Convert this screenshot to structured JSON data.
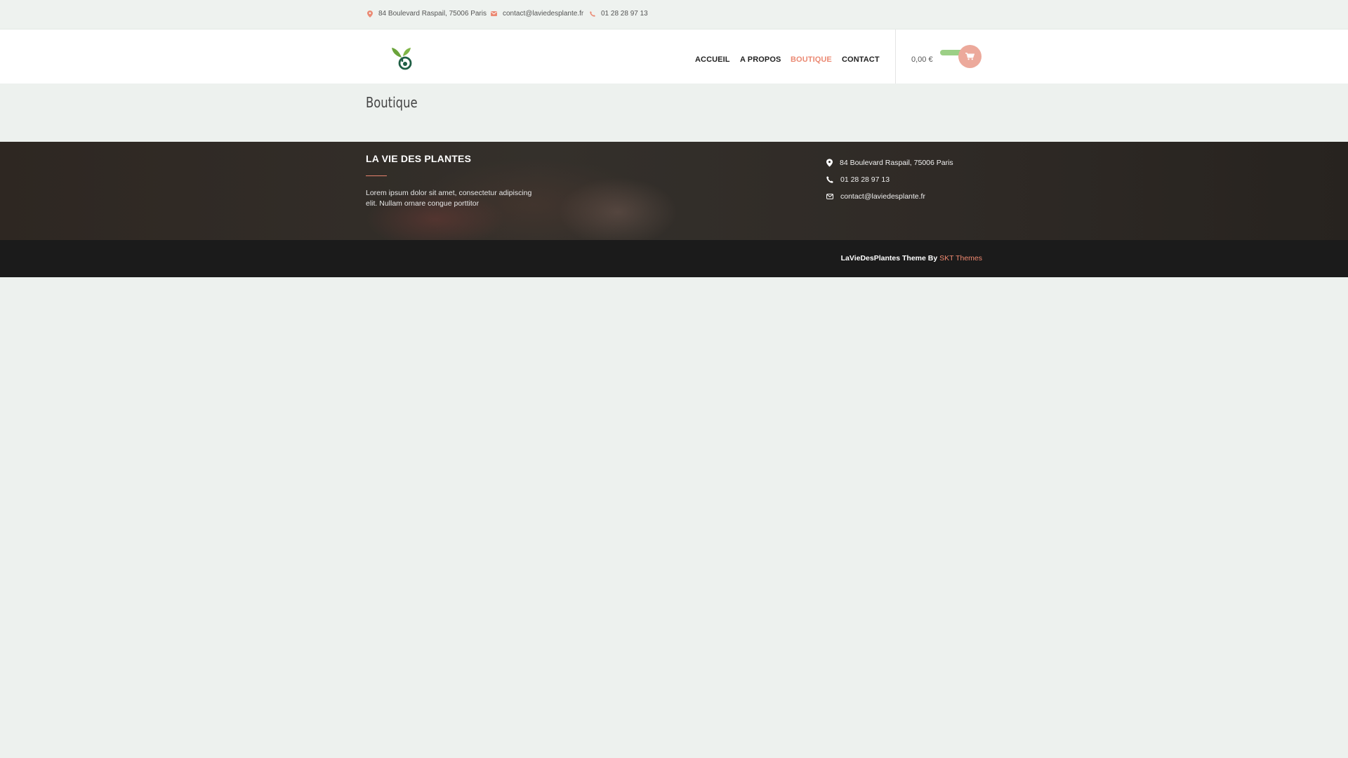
{
  "topbar": {
    "address": "84 Boulevard Raspail, 75006 Paris",
    "email": "contact@laviedesplante.fr",
    "phone": "01 28 28 97 13"
  },
  "header": {
    "logo_icon": "plant-sprout-logo",
    "nav": [
      "ACCUEIL",
      "A PROPOS",
      "BOUTIQUE",
      "CONTACT"
    ],
    "active_nav": "BOUTIQUE",
    "cart_total": "0,00 €",
    "cart_icon": "shopping-cart-icon"
  },
  "page": {
    "title": "Boutique"
  },
  "footer": {
    "title": "LA VIE DES PLANTES",
    "text": "Lorem ipsum dolor sit amet, consectetur adipiscing elit. Nullam ornare congue porttitor",
    "contact": {
      "address": "84 Boulevard Raspail, 75006 Paris",
      "phone": "01 28 28 97 13",
      "email": "contact@laviedesplante.fr"
    }
  },
  "credits": {
    "prefix": "LaVieDesPlantes Theme By",
    "link": "SKT Themes"
  },
  "colors": {
    "accent": "#eb8a74",
    "cart_bubble": "#eca99b",
    "cart_pill": "#9ccf86",
    "footer_bg": "#2f2a26",
    "bottom_bg": "#1b1b1b",
    "page_bg": "#edf1ee"
  }
}
